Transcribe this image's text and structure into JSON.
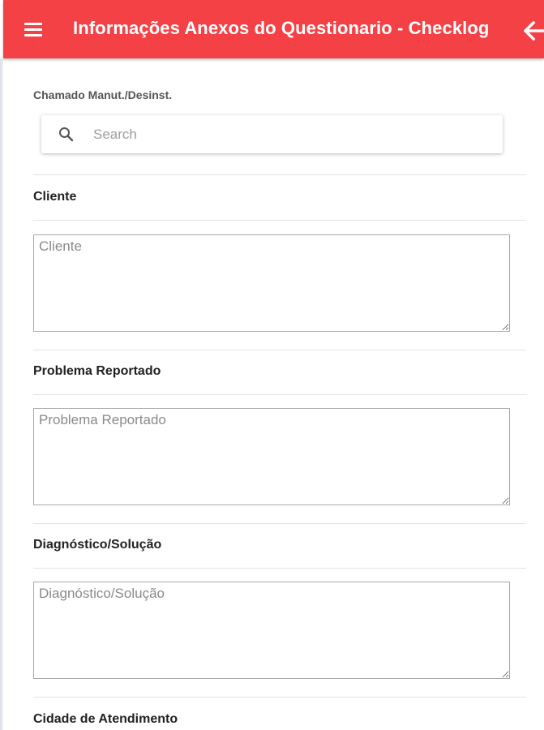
{
  "header": {
    "menu_icon": "hamburger-menu-icon",
    "title": "Informações Anexos do Questionario - Checklog",
    "back_icon": "arrow-left-icon"
  },
  "chamado": {
    "label": "Chamado Manut./Desinst.",
    "search_icon": "magnifier-icon",
    "search_placeholder": "Search",
    "search_value": ""
  },
  "sections": [
    {
      "title": "Cliente",
      "placeholder": "Cliente",
      "value": ""
    },
    {
      "title": "Problema Reportado",
      "placeholder": "Problema Reportado",
      "value": ""
    },
    {
      "title": "Diagnóstico/Solução",
      "placeholder": "Diagnóstico/Solução",
      "value": ""
    },
    {
      "title": "Cidade de Atendimento"
    }
  ],
  "colors": {
    "accent": "#f44145",
    "header_text": "#ffffff",
    "field_border": "#a9a9a9",
    "divider": "#e3e3e3"
  }
}
